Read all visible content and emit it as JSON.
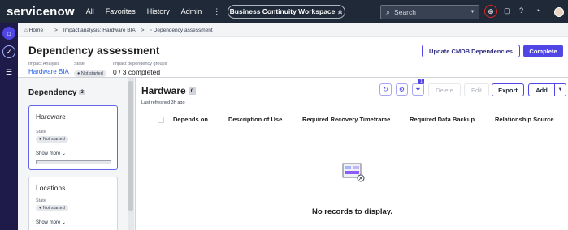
{
  "nav": {
    "brand": "servicenow",
    "links": [
      "All",
      "Favorites",
      "History",
      "Admin",
      "⋮"
    ],
    "workspace": "Business Continuity Workspace ☆",
    "search_placeholder": "Search"
  },
  "breadcrumb": {
    "home": "Home",
    "sep": ">",
    "item1": "Impact analysis: Hardware BIA",
    "item2": "Dependency assessment"
  },
  "header": {
    "title": "Dependency assessment",
    "impact_label": "Impact Analysis",
    "impact_value": "Hardware BIA",
    "state_label": "State",
    "state_value": "Not started",
    "groups_label": "Impact dependency groups",
    "groups_value": "0 / 3 completed",
    "update_button": "Update CMDB Dependencies",
    "complete_button": "Complete"
  },
  "left": {
    "title": "Dependency",
    "count": "3",
    "cards": [
      {
        "name": "Hardware",
        "state_label": "State",
        "state": "Not started",
        "more": "Show more",
        "progress": 0
      },
      {
        "name": "Locations",
        "state_label": "State",
        "state": "Not started",
        "more": "Show more"
      }
    ]
  },
  "main": {
    "title": "Hardware",
    "count": "0",
    "refreshed": "Last refreshed 3h ago",
    "filter_badge": "1",
    "delete": "Delete",
    "edit": "Edit",
    "export": "Export",
    "add": "Add",
    "columns": [
      "Depends on",
      "Description of Use",
      "Required Recovery Timeframe",
      "Required Data Backup",
      "Relationship Source"
    ],
    "empty": "No records to display."
  }
}
